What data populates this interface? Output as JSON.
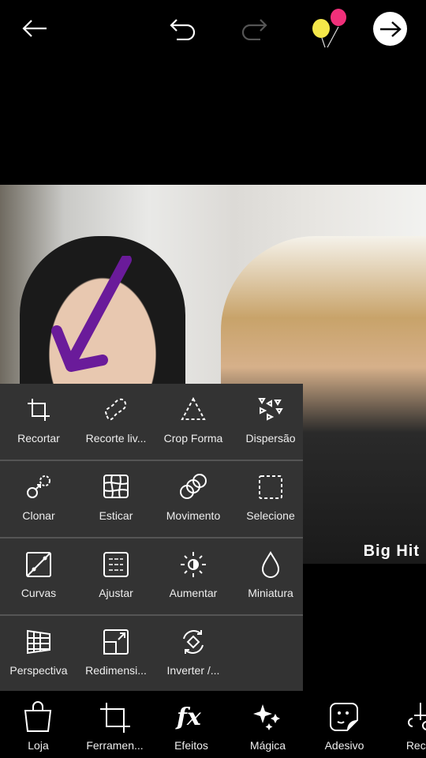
{
  "topbar": {
    "back_icon": "arrow-left-icon",
    "undo_icon": "undo-icon",
    "redo_icon": "redo-icon",
    "balloons_icon": "balloons-icon",
    "next_icon": "arrow-right-circle-icon"
  },
  "canvas": {
    "watermark": "Big Hit",
    "annotation_color": "#6a1b9a"
  },
  "tools": [
    {
      "label": "Recortar",
      "icon": "crop-icon"
    },
    {
      "label": "Recorte liv...",
      "icon": "free-crop-icon"
    },
    {
      "label": "Crop Forma",
      "icon": "shape-crop-icon"
    },
    {
      "label": "Dispersão",
      "icon": "dispersion-icon"
    },
    {
      "label": "Clonar",
      "icon": "clone-icon"
    },
    {
      "label": "Esticar",
      "icon": "stretch-icon"
    },
    {
      "label": "Movimento",
      "icon": "motion-icon"
    },
    {
      "label": "Selecione",
      "icon": "select-icon"
    },
    {
      "label": "Curvas",
      "icon": "curves-icon"
    },
    {
      "label": "Ajustar",
      "icon": "adjust-icon"
    },
    {
      "label": "Aumentar",
      "icon": "enhance-icon"
    },
    {
      "label": "Miniatura",
      "icon": "tilt-shift-icon"
    },
    {
      "label": "Perspectiva",
      "icon": "perspective-icon"
    },
    {
      "label": "Redimensi...",
      "icon": "resize-icon"
    },
    {
      "label": "Inverter /...",
      "icon": "flip-rotate-icon"
    }
  ],
  "bottombar": [
    {
      "label": "Loja",
      "icon": "shop-bag-icon"
    },
    {
      "label": "Ferramen...",
      "icon": "tools-crop-icon"
    },
    {
      "label": "Efeitos",
      "icon": "fx-icon"
    },
    {
      "label": "Mágica",
      "icon": "magic-sparkle-icon"
    },
    {
      "label": "Adesivo",
      "icon": "sticker-icon"
    },
    {
      "label": "Recor",
      "icon": "cutout-icon"
    }
  ]
}
